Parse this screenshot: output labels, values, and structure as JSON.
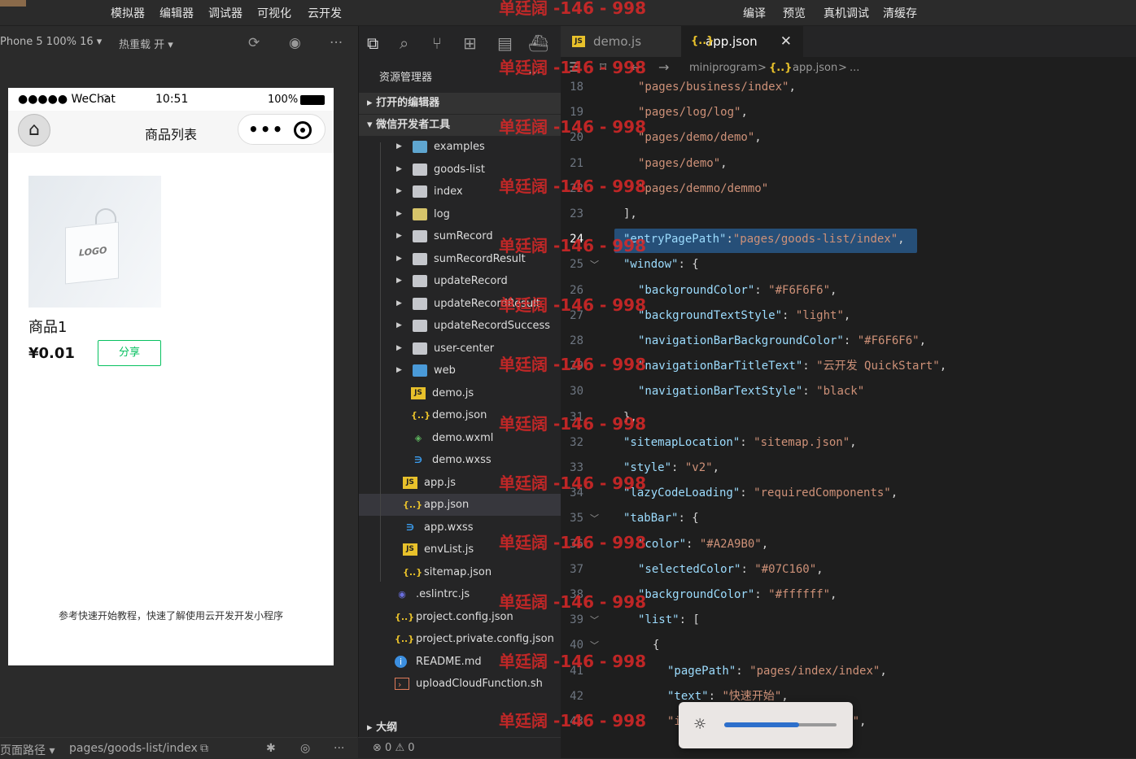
{
  "menu": [
    "模拟器",
    "编辑器",
    "调试器",
    "可视化",
    "云开发"
  ],
  "menu_right": [
    "编译",
    "预览",
    "真机调试",
    "清缓存"
  ],
  "sim_toolbar": {
    "device": "Phone 5 100% 16 ▾",
    "hotreload": "热重载 开 ▾"
  },
  "phone": {
    "carrier": "●●●●● WeChat",
    "wifi": "⌔",
    "time": "10:51",
    "battery": "100%",
    "title": "商品列表",
    "goods_name": "商品1",
    "goods_price": "¥0.01",
    "share": "分享",
    "bag_logo": "LOGO",
    "hint": "参考快速开始教程，快速了解使用云开发开发小程序"
  },
  "sim_bottom": {
    "label": "页面路径 ▾",
    "path": "pages/goods-list/index"
  },
  "explorer": {
    "title": "资源管理器",
    "more": "···",
    "section_open": "打开的编辑器",
    "section_root": "微信开发者工具",
    "section_outline": "大纲",
    "items": [
      {
        "label": "examples",
        "icon": "folder-examples-icon"
      },
      {
        "label": "goods-list",
        "icon": "folder-icon"
      },
      {
        "label": "index",
        "icon": "folder-icon"
      },
      {
        "label": "log",
        "icon": "folder-log-icon"
      },
      {
        "label": "sumRecord",
        "icon": "folder-icon"
      },
      {
        "label": "sumRecordResult",
        "icon": "folder-icon"
      },
      {
        "label": "updateRecord",
        "icon": "folder-icon"
      },
      {
        "label": "updateRecordResult",
        "icon": "folder-icon"
      },
      {
        "label": "updateRecordSuccess",
        "icon": "folder-icon"
      },
      {
        "label": "user-center",
        "icon": "folder-icon"
      },
      {
        "label": "web",
        "icon": "folder-web-icon"
      },
      {
        "label": "demo.js",
        "icon": "js-file-icon"
      },
      {
        "label": "demo.json",
        "icon": "json-file-icon"
      },
      {
        "label": "demo.wxml",
        "icon": "wxml-file-icon"
      },
      {
        "label": "demo.wxss",
        "icon": "wxss-file-icon"
      },
      {
        "label": "app.js",
        "icon": "js-file-icon"
      },
      {
        "label": "app.json",
        "icon": "json-file-icon"
      },
      {
        "label": "app.wxss",
        "icon": "wxss-file-icon"
      },
      {
        "label": "envList.js",
        "icon": "js-file-icon"
      },
      {
        "label": "sitemap.json",
        "icon": "json-file-icon"
      },
      {
        "label": ".eslintrc.js",
        "icon": "eslint-file-icon"
      },
      {
        "label": "project.config.json",
        "icon": "json-file-icon"
      },
      {
        "label": "project.private.config.json",
        "icon": "json-file-icon"
      },
      {
        "label": "README.md",
        "icon": "info-file-icon"
      },
      {
        "label": "uploadCloudFunction.sh",
        "icon": "shell-file-icon"
      }
    ],
    "status_errors": "0",
    "status_warnings": "0"
  },
  "editor": {
    "tabs": [
      {
        "label": "demo.js"
      },
      {
        "label": "app.json",
        "close": "✕"
      }
    ],
    "breadcrumb": [
      "miniprogram",
      ">",
      "{..}",
      "app.json",
      ">",
      "..."
    ],
    "lines": [
      {
        "n": "18",
        "t": "\"pages/business/index\",",
        "ind": 2
      },
      {
        "n": "19",
        "t": "\"pages/log/log\",",
        "ind": 2
      },
      {
        "n": "20",
        "t": "\"pages/demo/demo\",",
        "ind": 2
      },
      {
        "n": "21",
        "t": "\"pages/demo\",",
        "ind": 2
      },
      {
        "n": "22",
        "t": "\"pages/demmo/demmo\"",
        "ind": 2
      },
      {
        "n": "23",
        "t": "],",
        "ind": 1
      },
      {
        "n": "24",
        "t": "\"entryPagePath\":\"pages/goods-list/index\",",
        "ind": 1
      },
      {
        "n": "25",
        "t": "\"window\": {",
        "ind": 1
      },
      {
        "n": "26",
        "t": "\"backgroundColor\": \"#F6F6F6\",",
        "ind": 2
      },
      {
        "n": "27",
        "t": "\"backgroundTextStyle\": \"light\",",
        "ind": 2
      },
      {
        "n": "28",
        "t": "\"navigationBarBackgroundColor\": \"#F6F6F6\",",
        "ind": 2
      },
      {
        "n": "29",
        "t": "\"navigationBarTitleText\": \"云开发 QuickStart\",",
        "ind": 2
      },
      {
        "n": "30",
        "t": "\"navigationBarTextStyle\": \"black\"",
        "ind": 2
      },
      {
        "n": "31",
        "t": "},",
        "ind": 1
      },
      {
        "n": "32",
        "t": "\"sitemapLocation\": \"sitemap.json\",",
        "ind": 1
      },
      {
        "n": "33",
        "t": "\"style\": \"v2\",",
        "ind": 1
      },
      {
        "n": "34",
        "t": "\"lazyCodeLoading\": \"requiredComponents\",",
        "ind": 1
      },
      {
        "n": "35",
        "t": "\"tabBar\": {",
        "ind": 1
      },
      {
        "n": "36",
        "t": "\"color\": \"#A2A9B0\",",
        "ind": 2
      },
      {
        "n": "37",
        "t": "\"selectedColor\": \"#07C160\",",
        "ind": 2
      },
      {
        "n": "38",
        "t": "\"backgroundColor\": \"#ffffff\",",
        "ind": 2
      },
      {
        "n": "39",
        "t": "\"list\": [",
        "ind": 2
      },
      {
        "n": "40",
        "t": "{",
        "ind": 3
      },
      {
        "n": "41",
        "t": "\"pagePath\": \"pages/index/index\",",
        "ind": 4
      },
      {
        "n": "42",
        "t": "\"text\": \"快速开始\",",
        "ind": 4
      },
      {
        "n": "43",
        "t": "\"i                 home.png\",",
        "ind": 4
      }
    ]
  },
  "watermark": "单廷阔 -146 - 998",
  "brightness": {
    "level": 0.67,
    "icon": "sun-icon"
  },
  "colors": {
    "accent": "#07c160",
    "selection": "#264f78",
    "watermark": "#dc2828"
  }
}
